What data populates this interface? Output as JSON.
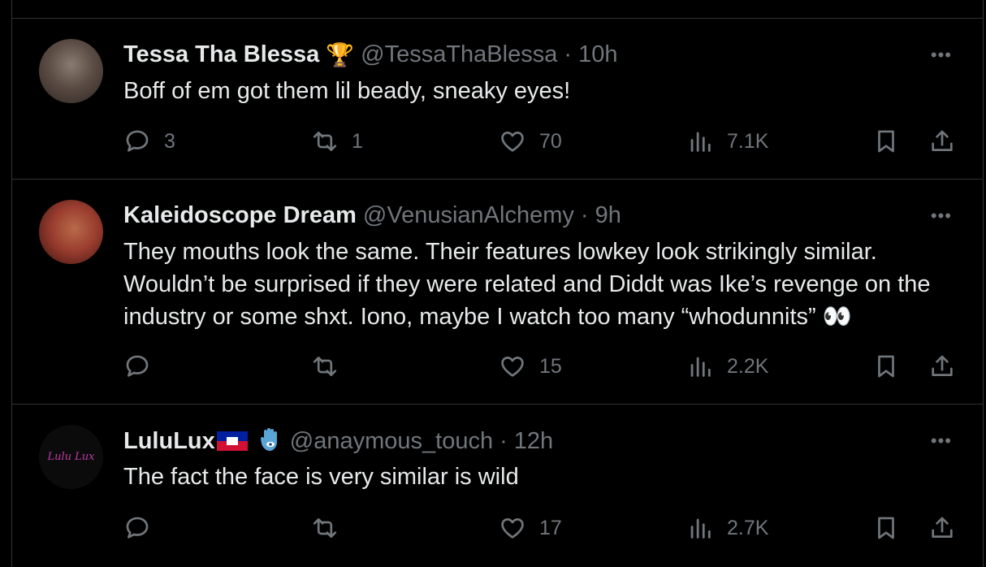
{
  "tweets": [
    {
      "name": "Tessa Tha Blessa",
      "badge": "🏆",
      "handle": "@TessaThaBlessa",
      "time": "· 10h",
      "text": "Boff of em got them lil beady, sneaky eyes!",
      "replies": "3",
      "retweets": "1",
      "likes": "70",
      "views": "7.1K"
    },
    {
      "name": "Kaleidoscope Dream",
      "handle": "@VenusianAlchemy",
      "time": "· 9h",
      "text": "They mouths look the same. Their features lowkey look strikingly similar. Wouldn’t be surprised if they were related and Diddt was Ike’s revenge on the industry or some shxt. Iono, maybe I watch too many “whodunnits” 👀",
      "replies": "",
      "retweets": "",
      "likes": "15",
      "views": "2.2K"
    },
    {
      "name": "LuluLux",
      "handle": "@anaymous_touch",
      "time": "· 12h",
      "avatar_text": "Lulu Lux",
      "text": "The fact the face is very similar is wild",
      "replies": "",
      "retweets": "",
      "likes": "17",
      "views": "2.7K"
    }
  ],
  "more_label": "•••",
  "icons": [
    "reply-icon",
    "retweet-icon",
    "like-icon",
    "views-icon",
    "bookmark-icon",
    "share-icon",
    "more-icon"
  ],
  "colors": {
    "background": "#000000",
    "text": "#e7e9ea",
    "muted": "#71767b",
    "divider": "#2f3336"
  }
}
